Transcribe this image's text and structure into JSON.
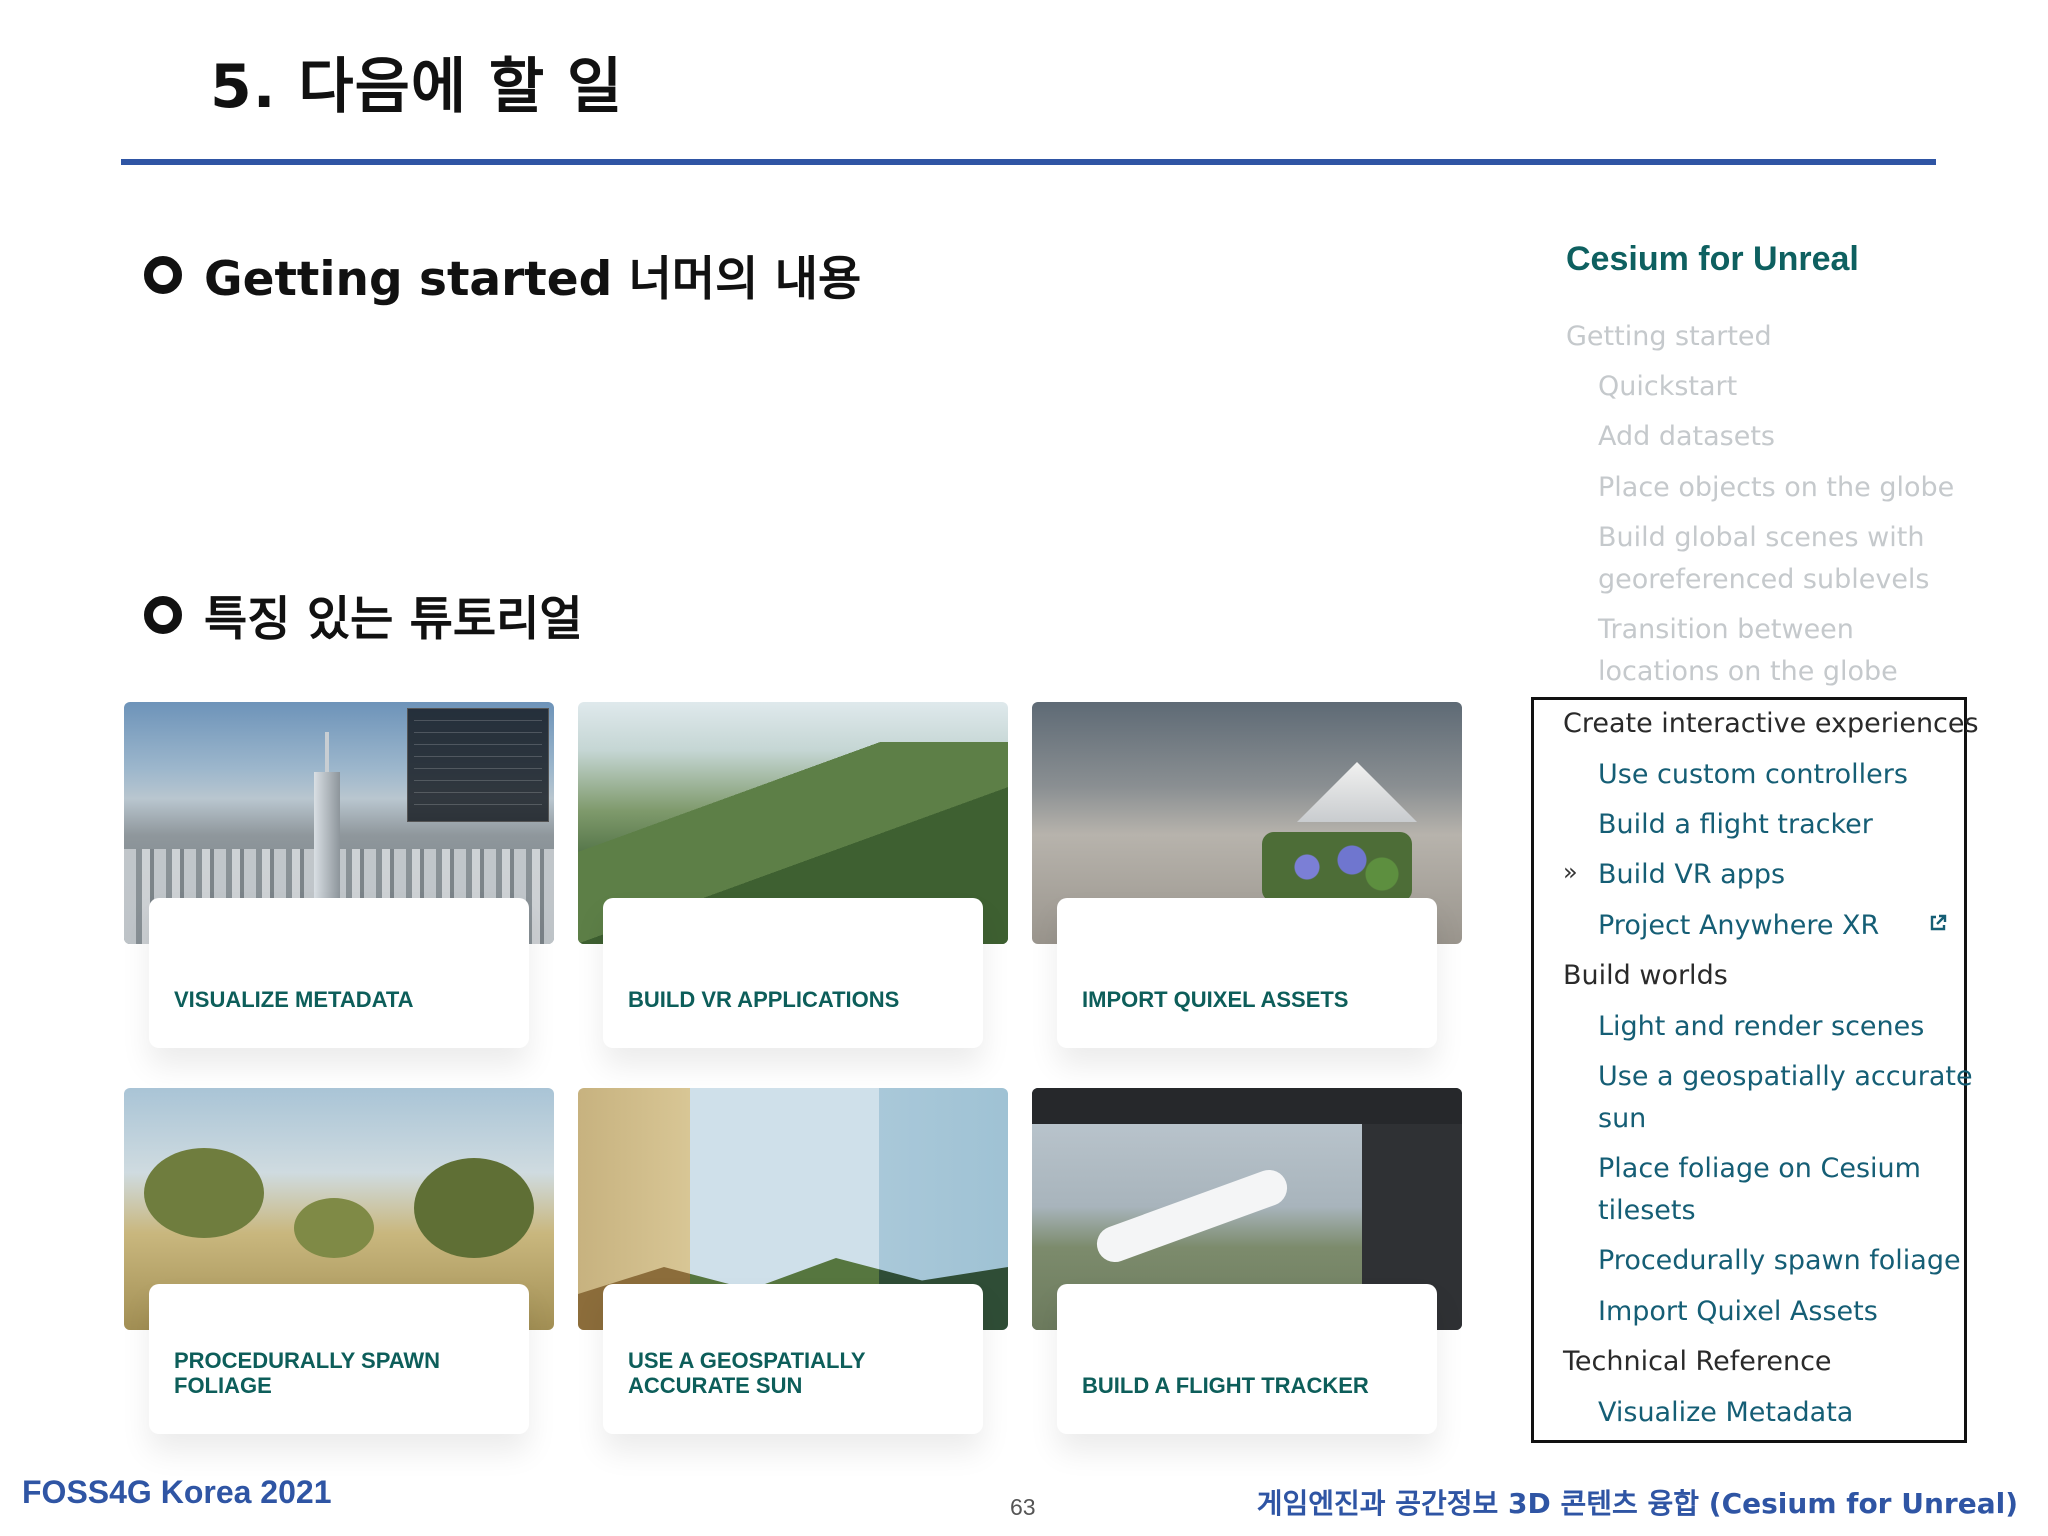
{
  "slide": {
    "title": "5. 다음에 할 일",
    "bullets": [
      "Getting started 너머의 내용",
      "특징 있는 튜토리얼"
    ],
    "accent_color": "#2f55a4"
  },
  "tutorial_cards": [
    {
      "label": "VISUALIZE METADATA",
      "icon": "city-metadata-image"
    },
    {
      "label": "BUILD VR APPLICATIONS",
      "icon": "mountain-image"
    },
    {
      "label": "IMPORT QUIXEL ASSETS",
      "icon": "street-scene-image"
    },
    {
      "label": "PROCEDURALLY SPAWN FOLIAGE",
      "icon": "foliage-image"
    },
    {
      "label": "USE A GEOSPATIALLY ACCURATE SUN",
      "icon": "sun-landscape-image"
    },
    {
      "label": "BUILD A FLIGHT TRACKER",
      "icon": "editor-airplane-image"
    }
  ],
  "sidebar": {
    "title": "Cesium for Unreal",
    "title_color": "#0e6060",
    "getting_started": {
      "heading": "Getting started",
      "items": [
        "Quickstart",
        "Add datasets",
        "Place objects on the globe",
        "Build global scenes with",
        "georeferenced sublevels",
        "Transition between",
        "locations on the globe"
      ]
    },
    "interactive": {
      "heading": "Create interactive experiences",
      "items": [
        "Use custom controllers",
        "Build a flight tracker",
        "Build VR apps",
        "Project Anywhere XR"
      ],
      "current_marker": "»"
    },
    "worlds": {
      "heading": "Build worlds",
      "items": [
        "Light and render scenes",
        "Use a geospatially accurate",
        "sun",
        "Place foliage on Cesium",
        "tilesets",
        "Procedurally spawn foliage",
        "Import Quixel Assets"
      ]
    },
    "reference": {
      "heading": "Technical Reference",
      "items": [
        "Visualize Metadata"
      ]
    }
  },
  "footer": {
    "left": "FOSS4G Korea 2021",
    "page": "63",
    "right": "게임엔진과 공간정보 3D 콘텐츠 융합 (Cesium for Unreal)"
  }
}
